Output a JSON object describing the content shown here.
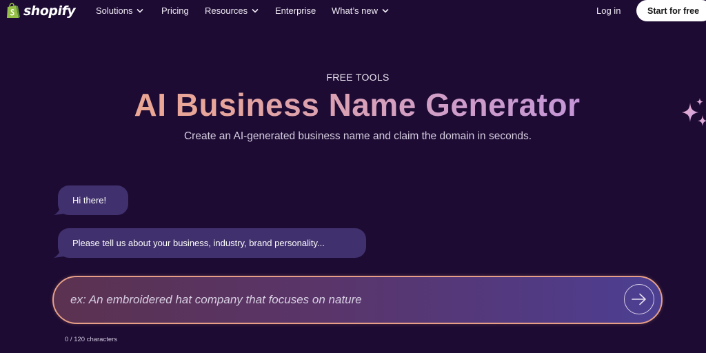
{
  "brand": {
    "name": "shopify",
    "logo_color": "#95bf47"
  },
  "nav": {
    "items": [
      {
        "label": "Solutions",
        "has_dropdown": true
      },
      {
        "label": "Pricing",
        "has_dropdown": false
      },
      {
        "label": "Resources",
        "has_dropdown": true
      },
      {
        "label": "Enterprise",
        "has_dropdown": false
      },
      {
        "label": "What’s new",
        "has_dropdown": true
      }
    ],
    "login_label": "Log in",
    "cta_label": "Start for free"
  },
  "hero": {
    "eyebrow": "FREE TOOLS",
    "title": "AI Business Name Generator",
    "subtitle": "Create an AI-generated business name and claim the domain in seconds."
  },
  "chat": {
    "messages": [
      {
        "text": "Hi there!"
      },
      {
        "text": "Please tell us about your business, industry, brand personality..."
      }
    ]
  },
  "prompt": {
    "value": "",
    "placeholder": "ex: An embroidered hat company that focuses on nature",
    "char_count": "0 / 120 characters",
    "send_icon": "arrow-right-icon"
  },
  "colors": {
    "background": "#1d0b33",
    "bubble": "#40306d",
    "input_border": "#e79f87",
    "cta_bg": "#ffffff"
  }
}
